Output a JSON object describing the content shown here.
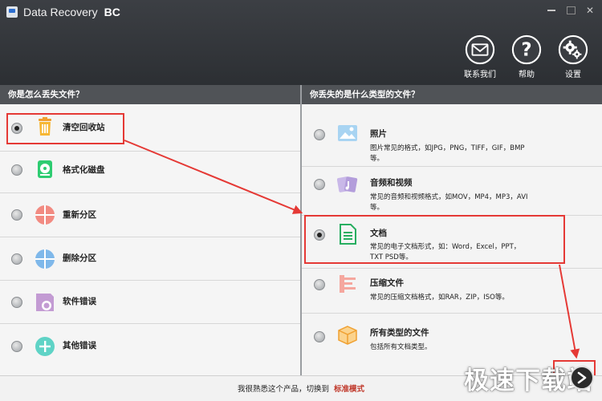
{
  "window": {
    "title": "Data Recovery",
    "edition": "BC"
  },
  "toolbar": [
    {
      "label": "联系我们",
      "icon": "envelope-icon"
    },
    {
      "label": "帮助",
      "icon": "help-icon"
    },
    {
      "label": "设置",
      "icon": "gear-icon"
    }
  ],
  "left_panel": {
    "header": "你是怎么丢失文件？",
    "options": [
      {
        "label": "清空回收站",
        "icon": "recycle-bin-icon",
        "checked": true
      },
      {
        "label": "格式化磁盘",
        "icon": "disk-format-icon",
        "checked": false
      },
      {
        "label": "重新分区",
        "icon": "repartition-icon",
        "checked": false
      },
      {
        "label": "删除分区",
        "icon": "delete-partition-icon",
        "checked": false
      },
      {
        "label": "软件错误",
        "icon": "software-error-icon",
        "checked": false
      },
      {
        "label": "其他错误",
        "icon": "other-error-icon",
        "checked": false
      }
    ]
  },
  "right_panel": {
    "header": "你丢失的是什么类型的文件？",
    "options": [
      {
        "label": "照片",
        "icon": "photo-icon",
        "checked": false,
        "desc": [
          "图片常见的格式，如JPG，PNG，TIFF，GIF，BMP",
          "等。"
        ]
      },
      {
        "label": "音频和视频",
        "icon": "audio-video-icon",
        "checked": false,
        "desc": [
          "常见的音频和视频格式，如MOV，MP4，MP3，AVI",
          "等。"
        ]
      },
      {
        "label": "文档",
        "icon": "document-icon",
        "checked": true,
        "desc": [
          "常见的电子文档形式，如：Word，Excel，PPT，",
          "TXT PSD等。"
        ]
      },
      {
        "label": "压缩文件",
        "icon": "archive-icon",
        "checked": false,
        "desc": [
          "常见的压缩文档格式，如RAR，ZIP，ISO等。"
        ]
      },
      {
        "label": "所有类型的文件",
        "icon": "box-icon",
        "checked": false,
        "desc": [
          "包括所有文档类型。"
        ]
      }
    ]
  },
  "footer": {
    "text": "我很熟悉这个产品，切换到",
    "link": "标准模式"
  },
  "watermark": "极速下载站",
  "colors": {
    "header_bg": "#2f3236",
    "section_bg": "#505357",
    "highlight": "#e53935",
    "link": "#c0392b"
  }
}
